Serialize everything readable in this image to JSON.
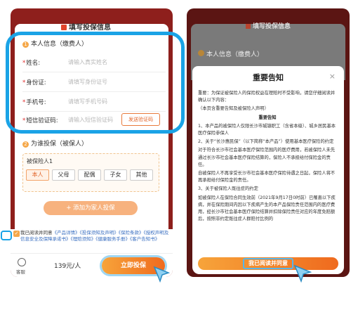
{
  "left": {
    "title": "填写投保信息",
    "section1": {
      "num": "1",
      "label": "本人信息（缴费人）"
    },
    "fields": [
      {
        "label": "姓名:",
        "placeholder": "请输入真实姓名"
      },
      {
        "label": "身份证:",
        "placeholder": "请填写身份证号"
      },
      {
        "label": "手机号:",
        "placeholder": "请填写手机号码"
      },
      {
        "label": "短信验证码:",
        "placeholder": "请输入短信验证码"
      }
    ],
    "send_code": "发送验证码",
    "section2": {
      "num": "2",
      "label": "为谁投保（被保人）"
    },
    "insured_label": "被保险人1",
    "relations": [
      "本人",
      "父母",
      "配偶",
      "子女",
      "其他"
    ],
    "add_family": "+ 添加为家人投保",
    "agree_prefix": "我已阅读并同意",
    "agree_links": [
      "《产品详情》",
      "《投保须知及声明》",
      "《保险条款》",
      "《授权声明及信息安全及保障承诺书》",
      "《理赔须知》",
      "《健康服务手册》",
      "《客户告知书》"
    ],
    "service_label": "客服",
    "price": "139元/人",
    "buy_button": "立即投保"
  },
  "right": {
    "title": "填写投保信息",
    "section1": "本人信息（缴费人）",
    "modal_title": "重要告知",
    "close": "×",
    "paragraphs": [
      "重要：为保证被保险人的保险权益在理赔时不受影响，请您仔细阅读并确认以下内容：",
      "（本页含重要告知及被保险人声明）",
      "重要告知",
      "1、本产品的被保险人仅限长沙市城镇职工（含省本级）、城乡居民基本医疗保险参保人",
      "2、关于“长沙惠民保”（以下简称“本产品”）使用基本医疗保险的约定",
      "对于符合长沙市社会基本医疗保险范围内的医疗费用，若被保险人未先通过长沙市社会基本医疗保险结算的，保险人不承担给付保险金的责任。",
      "自被保险人不再享受长沙市社会基本医疗保险待遇之日起，保险人将不再承担给付保险金的责任。",
      "3、关于被保险人既往症的约定",
      "如被保险人在保险合同生效前（2021年9月17日0时前）已罹患以下疾病，并在保险期间内因以下疾病产生的本产品保险责任范围内的医疗费用，经长沙市社会基本医疗保险结算并扣除保险责任对应的年度免赔额后，按照非约定既往症人群赔付比例的"
    ],
    "read_button": "我已阅读并同意"
  },
  "colors": {
    "accent": "#ef6a1e",
    "highlight": "#1aa3e6",
    "frame": "#8e1f1c"
  }
}
